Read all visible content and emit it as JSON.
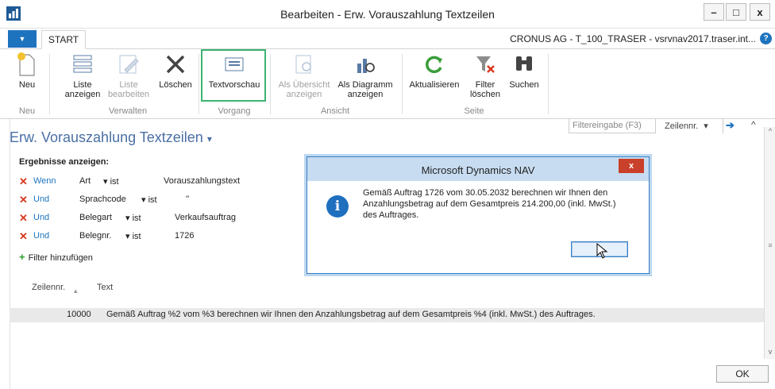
{
  "window": {
    "title": "Bearbeiten - Erw. Vorauszahlung Textzeilen",
    "minimize": "–",
    "maximize": "□",
    "close": "x"
  },
  "tabs": {
    "start": "START",
    "company": "CRONUS AG - T_100_TRASER - vsrvnav2017.traser.int...",
    "help": "?"
  },
  "ribbon": {
    "buttons": [
      {
        "label": "Neu",
        "icon": "new-document-icon",
        "enabled": true
      },
      {
        "label": "Liste anzeigen",
        "icon": "list-view-icon",
        "enabled": true
      },
      {
        "label": "Liste bearbeiten",
        "icon": "list-edit-icon",
        "enabled": false
      },
      {
        "label": "Löschen",
        "icon": "delete-icon",
        "enabled": true
      },
      {
        "label": "Textvorschau",
        "icon": "text-preview-icon",
        "enabled": true,
        "highlighted": true
      },
      {
        "label": "Als Übersicht anzeigen",
        "icon": "overview-icon",
        "enabled": false
      },
      {
        "label": "Als Diagramm anzeigen",
        "icon": "chart-icon",
        "enabled": true
      },
      {
        "label": "Aktualisieren",
        "icon": "refresh-icon",
        "enabled": true
      },
      {
        "label": "Filter löschen",
        "icon": "clear-filter-icon",
        "enabled": true
      },
      {
        "label": "Suchen",
        "icon": "binoculars-icon",
        "enabled": true
      }
    ],
    "groups": [
      "Neu",
      "Verwalten",
      "Vorgang",
      "Ansicht",
      "Seite"
    ]
  },
  "page": {
    "title": "Erw. Vorauszahlung Textzeilen",
    "title_dropdown": "▾",
    "filter_placeholder": "Filtereingabe (F3)",
    "sort_field": "Zeilennr.",
    "sort_chevron": "▾",
    "go": "➔",
    "collapse": "^"
  },
  "filters": {
    "heading": "Ergebnisse anzeigen:",
    "rows": [
      {
        "conj": "Wenn",
        "field": "Art",
        "op": "ist",
        "value": "Vorauszahlungstext"
      },
      {
        "conj": "Und",
        "field": "Sprachcode",
        "op": "ist",
        "value": "''"
      },
      {
        "conj": "Und",
        "field": "Belegart",
        "op": "ist",
        "value": "Verkaufsauftrag"
      },
      {
        "conj": "Und",
        "field": "Belegnr.",
        "op": "ist",
        "value": "1726"
      }
    ],
    "add_label": "Filter hinzufügen"
  },
  "table": {
    "headers": [
      "Zeilennr.",
      "Text"
    ],
    "rows": [
      {
        "no": "10000",
        "text": "Gemäß Auftrag %2 vom %3 berechnen wir Ihnen den Anzahlungsbetrag auf dem Gesamtpreis %4 (inkl. MwSt.) des Auftrages."
      }
    ]
  },
  "dialog": {
    "title": "Microsoft Dynamics NAV",
    "close": "x",
    "message_lines": [
      "Gemäß Auftrag 1726 vom 30.05.2032 berechnen wir Ihnen den",
      "Anzahlungsbetrag auf dem Gesamtpreis 214.200,00 (inkl. MwSt.)",
      "des Auftrages."
    ],
    "info": "i"
  },
  "footer": {
    "ok": "OK"
  },
  "colors": {
    "accent": "#1e73be",
    "highlight": "#3cb371",
    "danger": "#d9381e",
    "title_blue": "#4a6fa5"
  }
}
